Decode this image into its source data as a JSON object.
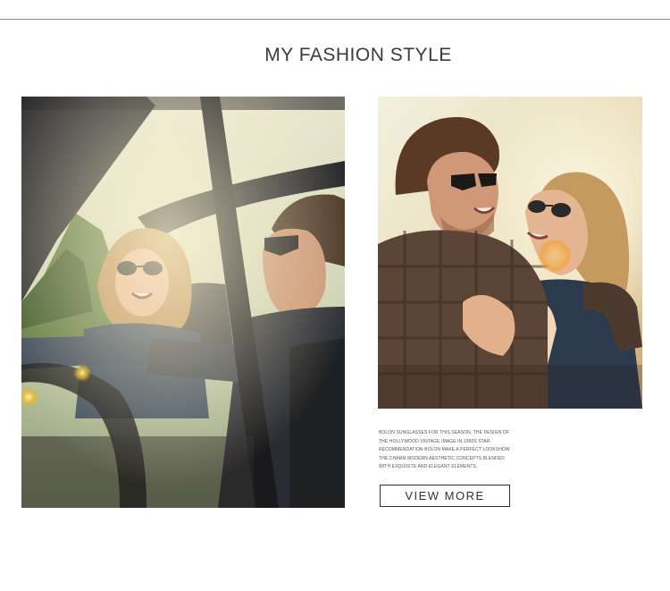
{
  "header": {
    "title": "MY FASHION STYLE"
  },
  "gallery": {
    "left_photo": {
      "subject": "couple-in-convertible-car-wearing-sunglasses"
    },
    "right_photo": {
      "subject": "couple-embracing-at-sunset-wearing-sunglasses"
    }
  },
  "promo": {
    "description": "BOLON SUNGLASSES FOR THIS SEASON, THE DESIGN OF THE HOLLYWOOD VINTAGE IMAGE IN 1950S STAR RECOMMENDATION BOLON MAKE A PERFECT LOOKSHOW THE CHARM MODERN AESTHETIC CONCEPTS BLENDED WITH EXQUISITE AND ELEGANT ELEMENTS.",
    "button_label": "VIEW MORE"
  },
  "colors": {
    "rule": "#8c8c8c",
    "text": "#333333",
    "background": "#ffffff"
  }
}
